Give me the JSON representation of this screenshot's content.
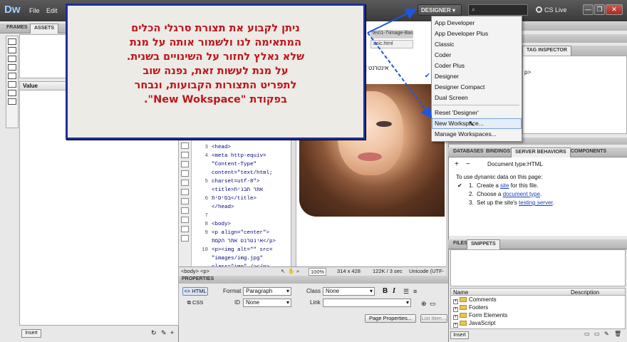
{
  "app": {
    "logo": "Dw",
    "menu": [
      "File",
      "Edit"
    ],
    "workspace_button": "DESIGNER",
    "cs_live": "CS Live",
    "window_controls": [
      "—",
      "❐",
      "✕"
    ]
  },
  "left_panel": {
    "tabs": [
      "FRAMES",
      "ASSETS"
    ],
    "value_header": "Value",
    "insert_button": "Insert"
  },
  "document": {
    "filename_tab": "asic.html",
    "path_tab": "tes\\1-7\\image-Bas",
    "hebrew_text": "אינטרנט אתר",
    "line_numbers": [
      "3",
      "4",
      "",
      "",
      "5",
      "",
      "6",
      "",
      "7",
      "8",
      "9",
      "",
      "10",
      "",
      ""
    ],
    "code_lines": [
      "<head>",
      "<meta http-equiv=",
      "\"Content-Type\"",
      "content=\"text/html;",
      "charset=utf-8\">",
      "<title>אתר תבנית",
      "בסיסית</title>",
      "</head>",
      "",
      "<body>",
      "<p align=\"center\">",
      "אינטרנט אתר הקמת</p>",
      "<p><img alt=\"\" src=",
      "\"images/img.jpg\"",
      "class=\"img\" /></p>"
    ],
    "status": {
      "tags": "<body> <p>",
      "zoom": "100%",
      "size": "314 x 428",
      "weight": "122K / 3 sec",
      "encoding": "Unicode (UTF-8"
    }
  },
  "properties": {
    "title": "PROPERTIES",
    "html_button": "HTML",
    "css_button": "CSS",
    "format_label": "Format",
    "format_value": "Paragraph",
    "class_label": "Class",
    "class_value": "None",
    "id_label": "ID",
    "id_value": "None",
    "link_label": "Link",
    "bold": "B",
    "italic": "I",
    "page_properties": "Page Properties...",
    "list_item": "List Item..."
  },
  "right_panel": {
    "tag_inspector": "TAG INSPECTOR",
    "business_catalyst": "BUSINESS CATALYST",
    "server_tabs": [
      "DATABASES",
      "BINDINGS",
      "SERVER BEHAVIORS",
      "COMPONENTS"
    ],
    "doc_type": "Document type:HTML",
    "dynamic_intro": "To use dynamic data on this page:",
    "steps": [
      {
        "num": "1.",
        "pre": "Create a ",
        "link": "site",
        "post": " for this file."
      },
      {
        "num": "2.",
        "pre": "Choose a ",
        "link": "document type",
        "post": "."
      },
      {
        "num": "3.",
        "pre": "Set up the site's ",
        "link": "testing server",
        "post": "."
      }
    ],
    "files_tabs": [
      "FILES",
      "SNIPPETS"
    ],
    "snippet_columns": [
      "Name",
      "Description"
    ],
    "snippets": [
      "Comments",
      "Footers",
      "Form Elements",
      "JavaScript"
    ],
    "snippet_insert": "Insert"
  },
  "workspace_menu": {
    "items": [
      "App Developer",
      "App Developer Plus",
      "Classic",
      "Coder",
      "Coder Plus",
      "Designer",
      "Designer Compact",
      "Dual Screen"
    ],
    "checked": "Designer",
    "actions": [
      "Reset 'Designer'",
      "New Workspace...",
      "Manage Workspaces..."
    ],
    "highlighted": "New Workspace..."
  },
  "callout": {
    "lines": [
      "ניתן לקבוע את תצורת סרגלי הכלים",
      "המתאימה לנו ולשמור אותה על מנת",
      "שלא נאלץ לחזור על השינויים בשנית.",
      "על מנת לעשות זאת, נפנה שוב",
      "לתפריט התצורות הקבועות, ונבחר",
      "בפקודת \"New Wokspace\"."
    ]
  },
  "colors": {
    "callout_border": "#1d2f98",
    "callout_text": "#c0141a",
    "arrow": "#1f56e0",
    "link": "#1a3fb5"
  }
}
